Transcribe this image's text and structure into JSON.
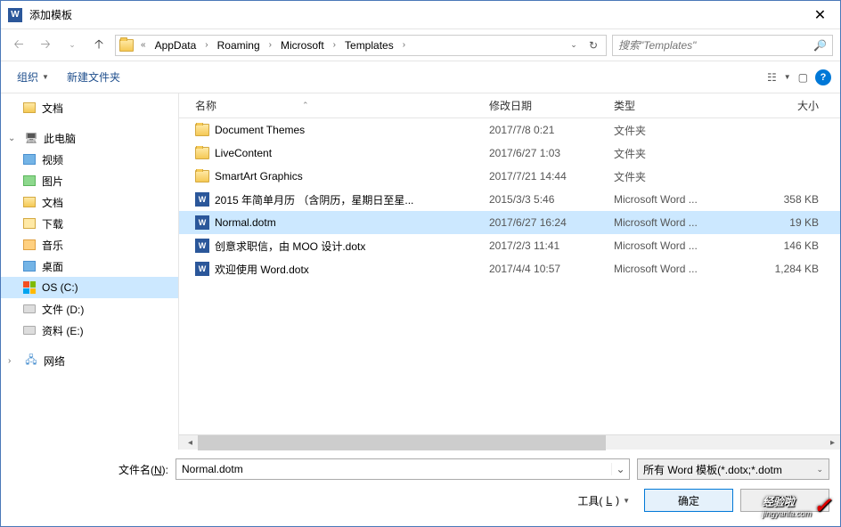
{
  "title": "添加模板",
  "breadcrumbs": [
    "AppData",
    "Roaming",
    "Microsoft",
    "Templates"
  ],
  "search_placeholder": "搜索\"Templates\"",
  "toolbar": {
    "organize": "组织",
    "new_folder": "新建文件夹"
  },
  "sidebar": {
    "docs": "文档",
    "this_pc": "此电脑",
    "video": "视频",
    "pictures": "图片",
    "documents": "文档",
    "downloads": "下载",
    "music": "音乐",
    "desktop": "桌面",
    "os_c": "OS (C:)",
    "data_d": "文件 (D:)",
    "data_e": "资料 (E:)",
    "network": "网络"
  },
  "columns": {
    "name": "名称",
    "date": "修改日期",
    "type": "类型",
    "size": "大小"
  },
  "rows": [
    {
      "icon": "folder",
      "name": "Document Themes",
      "date": "2017/7/8 0:21",
      "type": "文件夹",
      "size": ""
    },
    {
      "icon": "folder",
      "name": "LiveContent",
      "date": "2017/6/27 1:03",
      "type": "文件夹",
      "size": ""
    },
    {
      "icon": "folder",
      "name": "SmartArt Graphics",
      "date": "2017/7/21 14:44",
      "type": "文件夹",
      "size": ""
    },
    {
      "icon": "word",
      "name": "2015 年简单月历 （含阴历，星期日至星...",
      "date": "2015/3/3 5:46",
      "type": "Microsoft Word ...",
      "size": "358 KB"
    },
    {
      "icon": "word",
      "name": "Normal.dotm",
      "date": "2017/6/27 16:24",
      "type": "Microsoft Word ...",
      "size": "19 KB",
      "selected": true
    },
    {
      "icon": "word",
      "name": "创意求职信，由 MOO 设计.dotx",
      "date": "2017/2/3 11:41",
      "type": "Microsoft Word ...",
      "size": "146 KB"
    },
    {
      "icon": "word",
      "name": "欢迎使用 Word.dotx",
      "date": "2017/4/4 10:57",
      "type": "Microsoft Word ...",
      "size": "1,284 KB"
    }
  ],
  "footer": {
    "filename_label_pre": "文件名(",
    "filename_label_key": "N",
    "filename_label_post": "):",
    "filename_value": "Normal.dotm",
    "filter": "所有 Word 模板(*.dotx;*.dotm",
    "tools_pre": "工具(",
    "tools_key": "L",
    "tools_post": ")",
    "ok": "确定",
    "cancel": "取消"
  },
  "watermark": {
    "brand": "经验啦",
    "url": "jingyanla.com"
  }
}
